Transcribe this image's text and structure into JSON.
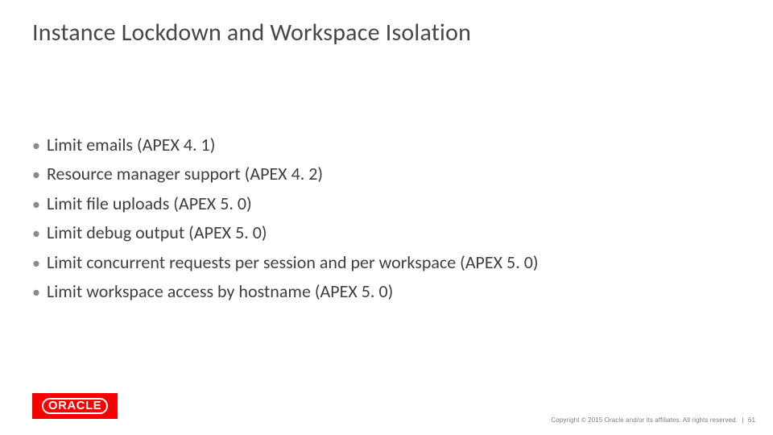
{
  "title": "Instance Lockdown and Workspace Isolation",
  "bullets": [
    "Limit emails (APEX 4. 1)",
    "Resource manager support (APEX 4. 2)",
    "Limit file uploads (APEX 5. 0)",
    "Limit debug output (APEX 5. 0)",
    "Limit concurrent requests per session and per workspace (APEX 5. 0)",
    "Limit workspace access by hostname (APEX 5. 0)"
  ],
  "logo": "ORACLE",
  "footer": {
    "copyright": "Copyright © 2015 Oracle and/or its affiliates. All rights reserved.",
    "page": "61"
  }
}
